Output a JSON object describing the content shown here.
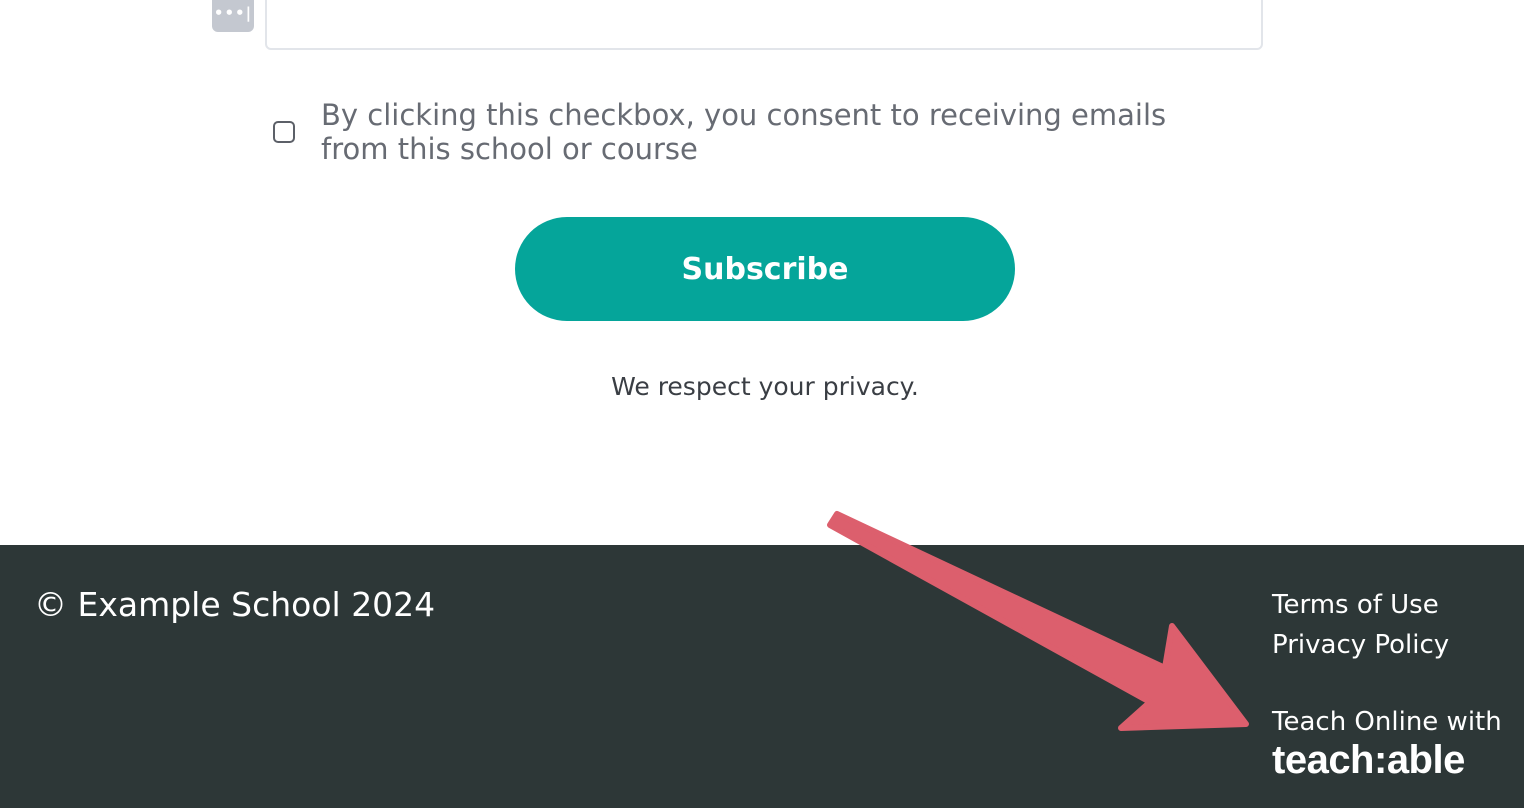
{
  "form": {
    "input_icon": "password-dots-icon",
    "input_icon_glyph": "•••|",
    "input_value": "",
    "consent_text": "By clicking this checkbox, you consent to receiving emails from this school or course",
    "consent_checked": false,
    "subscribe_label": "Subscribe",
    "privacy_note": "We respect your privacy."
  },
  "footer": {
    "copyright": "© Example School 2024",
    "links": [
      {
        "label": "Terms of Use"
      },
      {
        "label": "Privacy Policy"
      }
    ],
    "powered_by_label": "Teach Online with",
    "powered_by_logo": "teach:able"
  },
  "annotation": {
    "type": "arrow",
    "color": "#dc5f6d"
  },
  "colors": {
    "accent": "#05a59a",
    "footer_bg": "#2d3737",
    "text_muted": "#676b73",
    "arrow": "#dc5f6d"
  }
}
